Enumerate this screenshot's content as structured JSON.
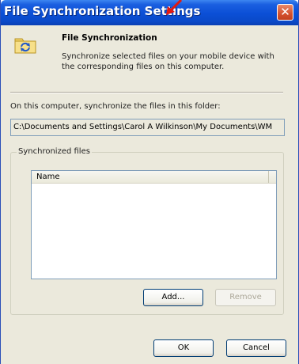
{
  "window": {
    "title": "File Synchronization Settings",
    "close_glyph": "✕"
  },
  "header": {
    "heading": "File Synchronization",
    "description": "Synchronize selected files on your mobile device with the corresponding files on this computer.",
    "icon": "folder-sync-icon"
  },
  "folder": {
    "label": "On this computer, synchronize the files in this folder:",
    "path": "C:\\Documents and Settings\\Carol A Wilkinson\\My Documents\\WM"
  },
  "synced_files": {
    "group_title": "Synchronized files",
    "columns": [
      "Name"
    ],
    "items": []
  },
  "buttons": {
    "add": "Add...",
    "remove": "Remove",
    "ok": "OK",
    "cancel": "Cancel"
  },
  "colors": {
    "titlebar": "#0b4fd6",
    "dialog_bg": "#ebe9dc",
    "annotation_arrow": "#e3190f"
  }
}
